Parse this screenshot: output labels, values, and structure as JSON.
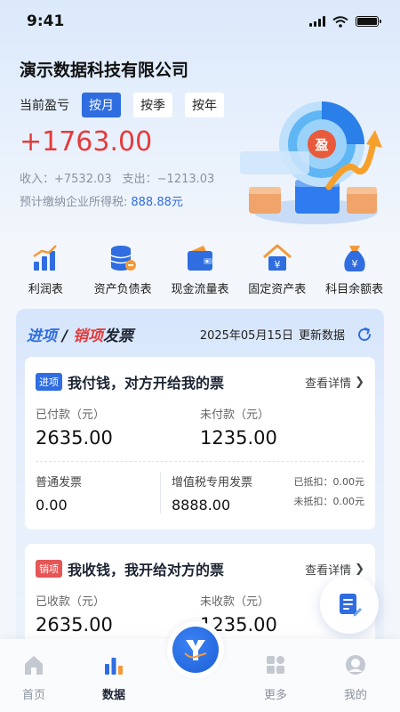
{
  "status_bar": {
    "time": "9:41"
  },
  "header": {
    "company": "演示数据科技有限公司",
    "period_label": "当前盈亏",
    "period_options": [
      "按月",
      "按季",
      "按年"
    ],
    "selected_period": "按月",
    "profit": "+1763.00",
    "income_label": "收入：+7532.03",
    "expense_label": "支出：−1213.03",
    "tax_label": "预计缴纳企业所得税:",
    "tax_amount": "888.88元",
    "illustration_text": "盈"
  },
  "toolbar": {
    "items": [
      {
        "label": "利润表",
        "icon": "bar-chart-icon"
      },
      {
        "label": "资产负债表",
        "icon": "coin-stack-icon"
      },
      {
        "label": "现金流量表",
        "icon": "wallet-icon"
      },
      {
        "label": "固定资产表",
        "icon": "house-yen-icon"
      },
      {
        "label": "科目余额表",
        "icon": "money-bag-icon"
      }
    ]
  },
  "panel": {
    "title_in": "进项",
    "title_sep": " / ",
    "title_out": "销项",
    "title_suffix": "发票",
    "date": "2025年05月15日",
    "update_label": "更新数据"
  },
  "card_in": {
    "tag": "进项",
    "title": "我付钱，对方开给我的票",
    "detail": "查看详情",
    "paid_label": "已付款（元）",
    "paid_value": "2635.00",
    "unpaid_label": "未付款（元）",
    "unpaid_value": "1235.00",
    "normal_label": "普通发票",
    "normal_value": "0.00",
    "vat_label": "增值税专用发票",
    "vat_value": "8888.00",
    "deducted": "已抵扣：0.00元",
    "undeducted": "未抵扣：0.00元"
  },
  "card_out": {
    "tag": "销项",
    "title": "我收钱，我开给对方的票",
    "detail": "查看详情",
    "received_label": "已收款（元）",
    "received_value": "2635.00",
    "unreceived_label": "未收款（元）",
    "unreceived_value": "1235.00"
  },
  "tabbar": {
    "tabs": [
      {
        "label": "首页",
        "icon": "home-icon"
      },
      {
        "label": "数据",
        "icon": "bar-chart-icon"
      },
      {
        "label": "更多",
        "icon": "grid-icon"
      },
      {
        "label": "我的",
        "icon": "user-icon"
      }
    ],
    "active": "数据"
  },
  "colors": {
    "accent": "#2f6de0",
    "profit": "#e53b3b",
    "tag_out": "#e55656"
  }
}
